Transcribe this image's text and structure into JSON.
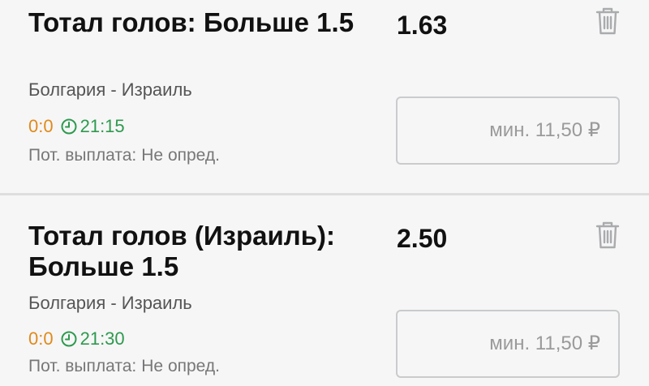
{
  "bets": [
    {
      "market": "Тотал голов: Больше 1.5",
      "odds": "1.63",
      "match": "Болгария - Израиль",
      "score": "0:0",
      "time": "21:15",
      "payout_label": "Пот. выплата:",
      "payout_value": "Не опред.",
      "stake_placeholder": "мин. 11,50 ₽",
      "delete_icon": "trash-icon"
    },
    {
      "market": "Тотал голов (Израиль): Больше 1.5",
      "odds": "2.50",
      "match": "Болгария - Израиль",
      "score": "0:0",
      "time": "21:30",
      "payout_label": "Пот. выплата:",
      "payout_value": "Не опред.",
      "stake_placeholder": "мин. 11,50 ₽",
      "delete_icon": "trash-icon"
    }
  ],
  "colors": {
    "score": "#e08a1a",
    "time": "#2e9a4e",
    "background": "#f6f6f7",
    "divider": "#dedede"
  }
}
